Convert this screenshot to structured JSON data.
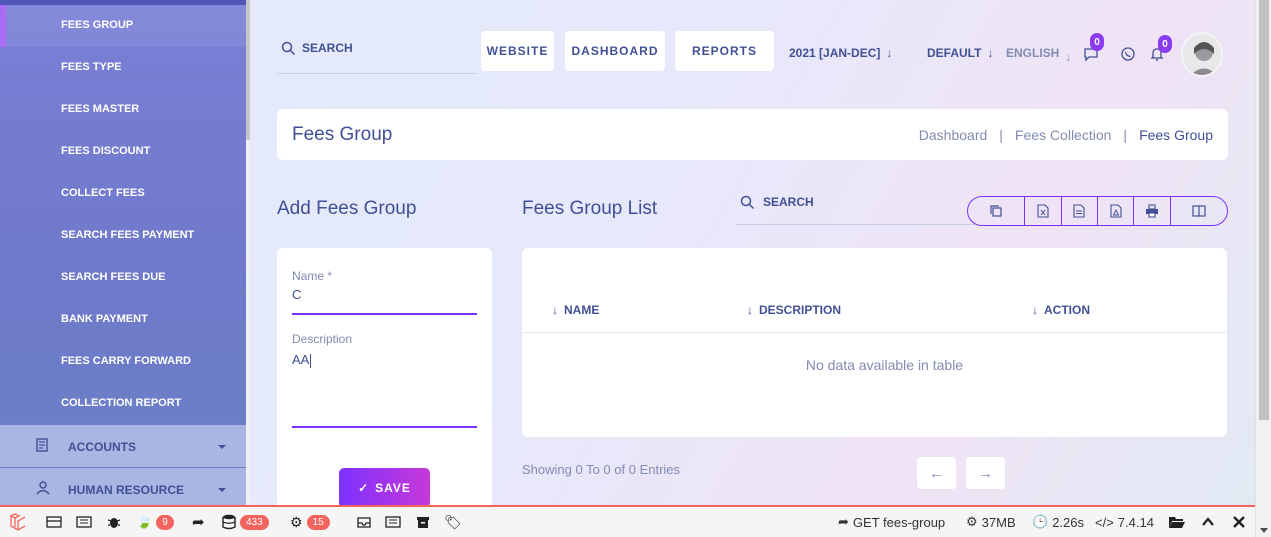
{
  "sidebar": {
    "items": [
      {
        "label": "FEES GROUP"
      },
      {
        "label": "FEES TYPE"
      },
      {
        "label": "FEES MASTER"
      },
      {
        "label": "FEES DISCOUNT"
      },
      {
        "label": "COLLECT FEES"
      },
      {
        "label": "SEARCH FEES PAYMENT"
      },
      {
        "label": "SEARCH FEES DUE"
      },
      {
        "label": "BANK PAYMENT"
      },
      {
        "label": "FEES CARRY FORWARD"
      },
      {
        "label": "COLLECTION REPORT"
      }
    ],
    "sections": [
      {
        "label": "ACCOUNTS"
      },
      {
        "label": "HUMAN RESOURCE"
      }
    ]
  },
  "header": {
    "search_placeholder": "SEARCH",
    "buttons": {
      "website": "WEBSITE",
      "dashboard": "DASHBOARD",
      "reports": "REPORTS"
    },
    "session": "2021 [JAN-DEC]",
    "style": "DEFAULT",
    "language": "ENGLISH",
    "messages_count": "0",
    "notifications_count": "0"
  },
  "page": {
    "title": "Fees Group",
    "breadcrumb": [
      "Dashboard",
      "Fees Collection",
      "Fees Group"
    ]
  },
  "form": {
    "heading": "Add Fees Group",
    "name_label": "Name *",
    "name_value": "C",
    "description_label": "Description",
    "description_value": "AA",
    "save_label": "SAVE"
  },
  "list": {
    "heading": "Fees Group List",
    "search_placeholder": "SEARCH",
    "columns": [
      "NAME",
      "DESCRIPTION",
      "ACTION"
    ],
    "empty_message": "No data available in table",
    "showing": "Showing 0 To 0 of 0 Entries"
  },
  "debugbar": {
    "views_count": "9",
    "queries_count": "433",
    "models_count": "15",
    "route": "GET fees-group",
    "memory": "37MB",
    "time": "2.26s",
    "php": "7.4.14"
  },
  "colors": {
    "primary": "#7c32ff",
    "text": "#415094",
    "muted": "#828bb2",
    "badge": "#f4645f"
  }
}
